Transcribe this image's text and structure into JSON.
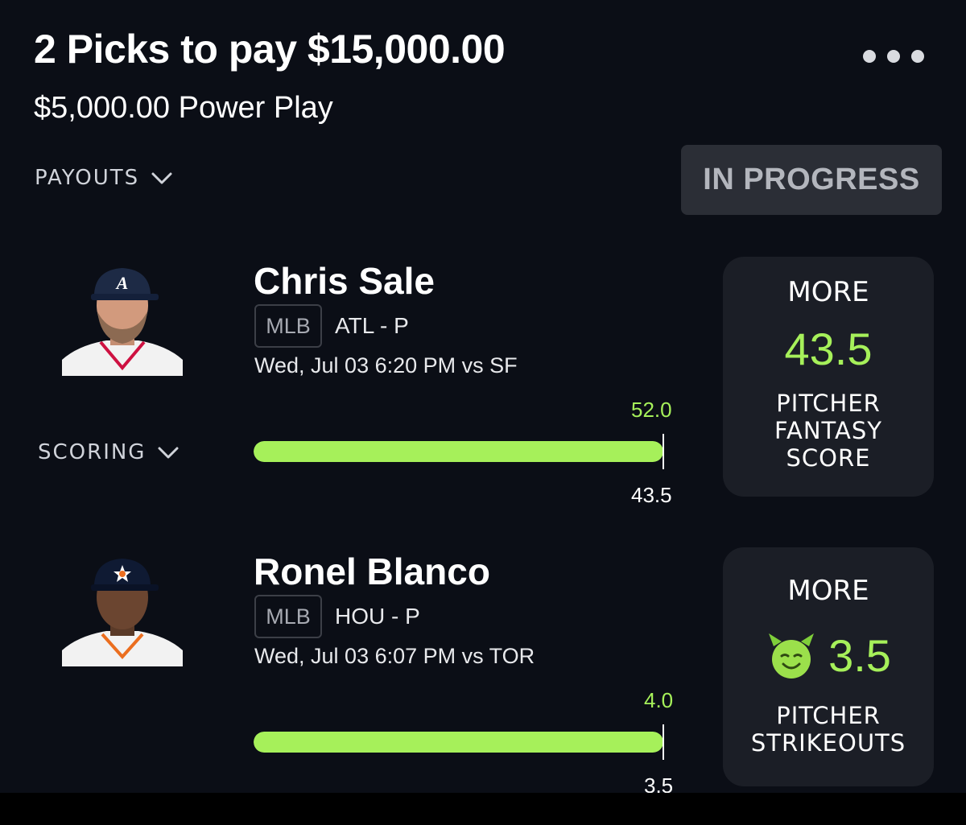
{
  "header": {
    "title": "2 Picks to pay $15,000.00",
    "subtitle": "$5,000.00 Power Play",
    "more_icon": "more-dots-icon"
  },
  "payouts_toggle": {
    "label": "PAYOUTS",
    "icon": "chevron-down-icon"
  },
  "status": {
    "label": "IN PROGRESS"
  },
  "scoring_toggle": {
    "label": "SCORING",
    "icon": "chevron-down-icon"
  },
  "picks": [
    {
      "player": "Chris Sale",
      "league": "MLB",
      "team_position": "ATL - P",
      "game": "Wed, Jul 03 6:20 PM  vs SF",
      "actual": "52.0",
      "line": "43.5",
      "progress": 1.0,
      "direction": "MORE",
      "pick_line": "43.5",
      "stat": "PITCHER\nFANTASY\nSCORE",
      "cap_color": "#1d2a45",
      "jersey": "white"
    },
    {
      "player": "Ronel Blanco",
      "league": "MLB",
      "team_position": "HOU - P",
      "game": "Wed, Jul 03 6:07 PM  vs TOR",
      "actual": "4.0",
      "line": "3.5",
      "progress": 1.0,
      "direction": "MORE",
      "pick_line": "3.5",
      "stat": "PITCHER\nSTRIKEOUTS",
      "badge_icon": "demon-emoji-icon",
      "cap_color": "#0f1a33",
      "jersey": "white"
    }
  ],
  "colors": {
    "background": "#0b0e16",
    "accent_green": "#a6f05a",
    "card": "#1b1e26",
    "status_bg": "#2b2e36"
  }
}
